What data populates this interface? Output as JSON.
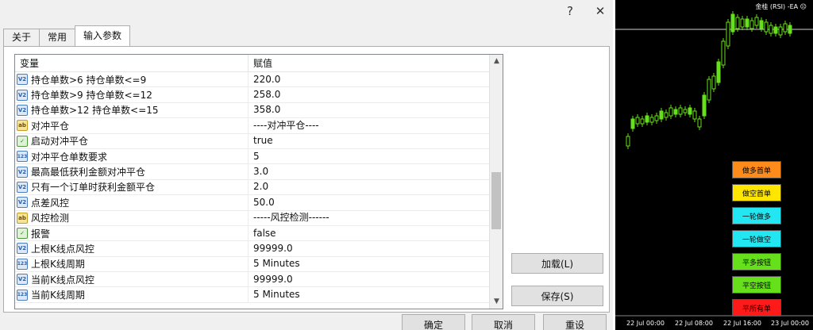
{
  "dialog": {
    "help_icon": "?",
    "close_icon": "✕",
    "tabs": [
      {
        "label": "关于"
      },
      {
        "label": "常用"
      },
      {
        "label": "输入参数"
      }
    ],
    "table": {
      "col_name": "变量",
      "col_value": "赋值",
      "rows": [
        {
          "icon": "v2",
          "name": "持仓单数>6   持仓单数<=9",
          "value": "220.0"
        },
        {
          "icon": "v2",
          "name": "持仓单数>9   持仓单数<=12",
          "value": "258.0"
        },
        {
          "icon": "v2",
          "name": "持仓单数>12  持仓单数<=15",
          "value": "358.0"
        },
        {
          "icon": "ab",
          "name": "对冲平仓",
          "value": "----对冲平仓----"
        },
        {
          "icon": "bool",
          "name": "启动对冲平仓",
          "value": "true"
        },
        {
          "icon": "n123",
          "name": "对冲平仓单数要求",
          "value": "5"
        },
        {
          "icon": "v2",
          "name": "最高最低获利金额对冲平仓",
          "value": "3.0"
        },
        {
          "icon": "v2",
          "name": "只有一个订单时获利金额平仓",
          "value": "2.0"
        },
        {
          "icon": "v2",
          "name": "点差风控",
          "value": "50.0"
        },
        {
          "icon": "ab",
          "name": "风控检测",
          "value": "-----风控检测------"
        },
        {
          "icon": "bool",
          "name": "报警",
          "value": "false"
        },
        {
          "icon": "v2",
          "name": "上根K线点风控",
          "value": "99999.0"
        },
        {
          "icon": "n123",
          "name": "上根K线周期",
          "value": "5 Minutes"
        },
        {
          "icon": "v2",
          "name": "当前K线点风控",
          "value": "99999.0"
        },
        {
          "icon": "n123",
          "name": "当前K线周期",
          "value": "5 Minutes"
        }
      ]
    },
    "buttons": {
      "load": "加载(L)",
      "save": "保存(S)",
      "ok": "确定",
      "cancel": "取消",
      "reset": "重设"
    }
  },
  "chart": {
    "title": "金桂 (RSI) -EA ☹",
    "x_labels": [
      "22 Jul 00:00",
      "22 Jul 08:00",
      "22 Jul 16:00",
      "23 Jul 00:00"
    ],
    "ea_buttons": [
      {
        "label": "做多首单",
        "color": "#ff8c1a"
      },
      {
        "label": "做空首单",
        "color": "#ffe600"
      },
      {
        "label": "一轮做多",
        "color": "#22e6f2"
      },
      {
        "label": "一轮做空",
        "color": "#22e6f2"
      },
      {
        "label": "平多按钮",
        "color": "#66e01a"
      },
      {
        "label": "平空按钮",
        "color": "#66e01a"
      },
      {
        "label": "平所有单",
        "color": "#ff1a1a"
      }
    ]
  }
}
